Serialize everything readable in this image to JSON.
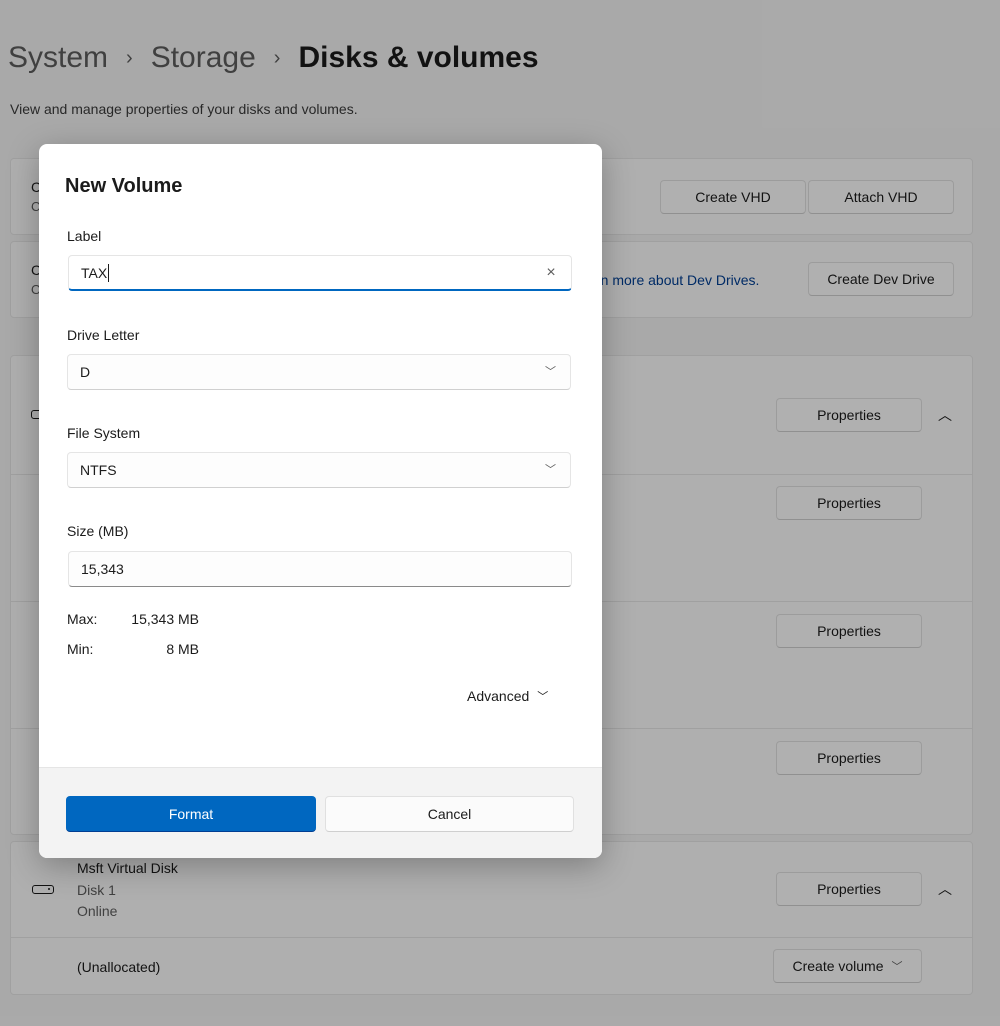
{
  "breadcrumb": {
    "items": [
      "System",
      "Storage",
      "Disks & volumes"
    ],
    "separator": "›"
  },
  "subtitle": "View and manage properties of your disks and volumes.",
  "background": {
    "vhd_card": {
      "title_partial": "C",
      "subtitle_partial": "C",
      "create_vhd_label": "Create VHD",
      "attach_vhd_label": "Attach VHD"
    },
    "dev_drive_card": {
      "title_partial": "C",
      "subtitle_partial": "O",
      "learn_more_link": "rn more about Dev Drives.",
      "create_dev_drive_label": "Create Dev Drive"
    },
    "disk0_card": {
      "properties_labels": [
        "Properties",
        "Properties",
        "Properties",
        "Properties"
      ],
      "collapse_icon": "chevron-up-icon"
    },
    "disk1_card": {
      "name": "Msft Virtual Disk",
      "disk_number": "Disk 1",
      "status": "Online",
      "properties_label": "Properties",
      "collapse_icon": "chevron-up-icon",
      "unallocated_label": "(Unallocated)",
      "create_volume_label": "Create volume"
    }
  },
  "dialog": {
    "title": "New Volume",
    "label_field": {
      "label": "Label",
      "value": "TAX",
      "clear_icon": "×"
    },
    "drive_letter": {
      "label": "Drive Letter",
      "value": "D"
    },
    "file_system": {
      "label": "File System",
      "value": "NTFS"
    },
    "size": {
      "label": "Size (MB)",
      "value": "15,343"
    },
    "limits": {
      "max_label": "Max:",
      "max_value": "15,343 MB",
      "min_label": "Min:",
      "min_value": "8 MB"
    },
    "advanced_label": "Advanced",
    "format_label": "Format",
    "cancel_label": "Cancel"
  },
  "colors": {
    "accent": "#0067c0",
    "link": "#003e92",
    "overlay": "rgba(0,0,0,0.30)"
  }
}
